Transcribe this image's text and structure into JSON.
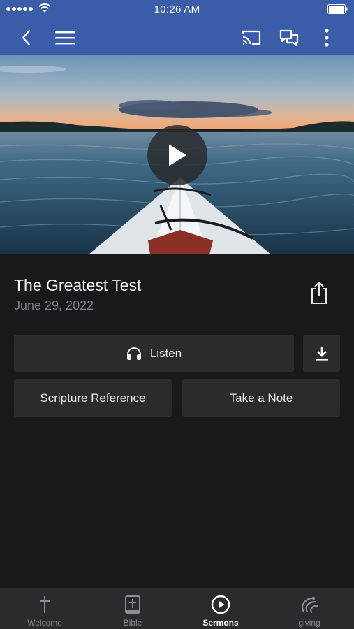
{
  "status_bar": {
    "time": "10:26 AM"
  },
  "nav": {
    "back_icon": "chevron-left-icon",
    "menu_icon": "hamburger-menu-icon",
    "cast_icon": "cast-icon",
    "chat_icon": "chat-bubbles-icon",
    "more_icon": "more-vertical-icon",
    "bar_color": "#3a5ca9"
  },
  "sermon": {
    "title": "The Greatest Test",
    "date": "June 29, 2022"
  },
  "actions": {
    "listen_label": "Listen",
    "scripture_label": "Scripture Reference",
    "note_label": "Take a Note"
  },
  "tabs": [
    {
      "label": "Welcome",
      "icon": "cross-icon",
      "active": false
    },
    {
      "label": "Bible",
      "icon": "bible-icon",
      "active": false
    },
    {
      "label": "Sermons",
      "icon": "play-circle-icon",
      "active": true
    },
    {
      "label": "giving",
      "icon": "giving-hand-icon",
      "active": false
    }
  ]
}
